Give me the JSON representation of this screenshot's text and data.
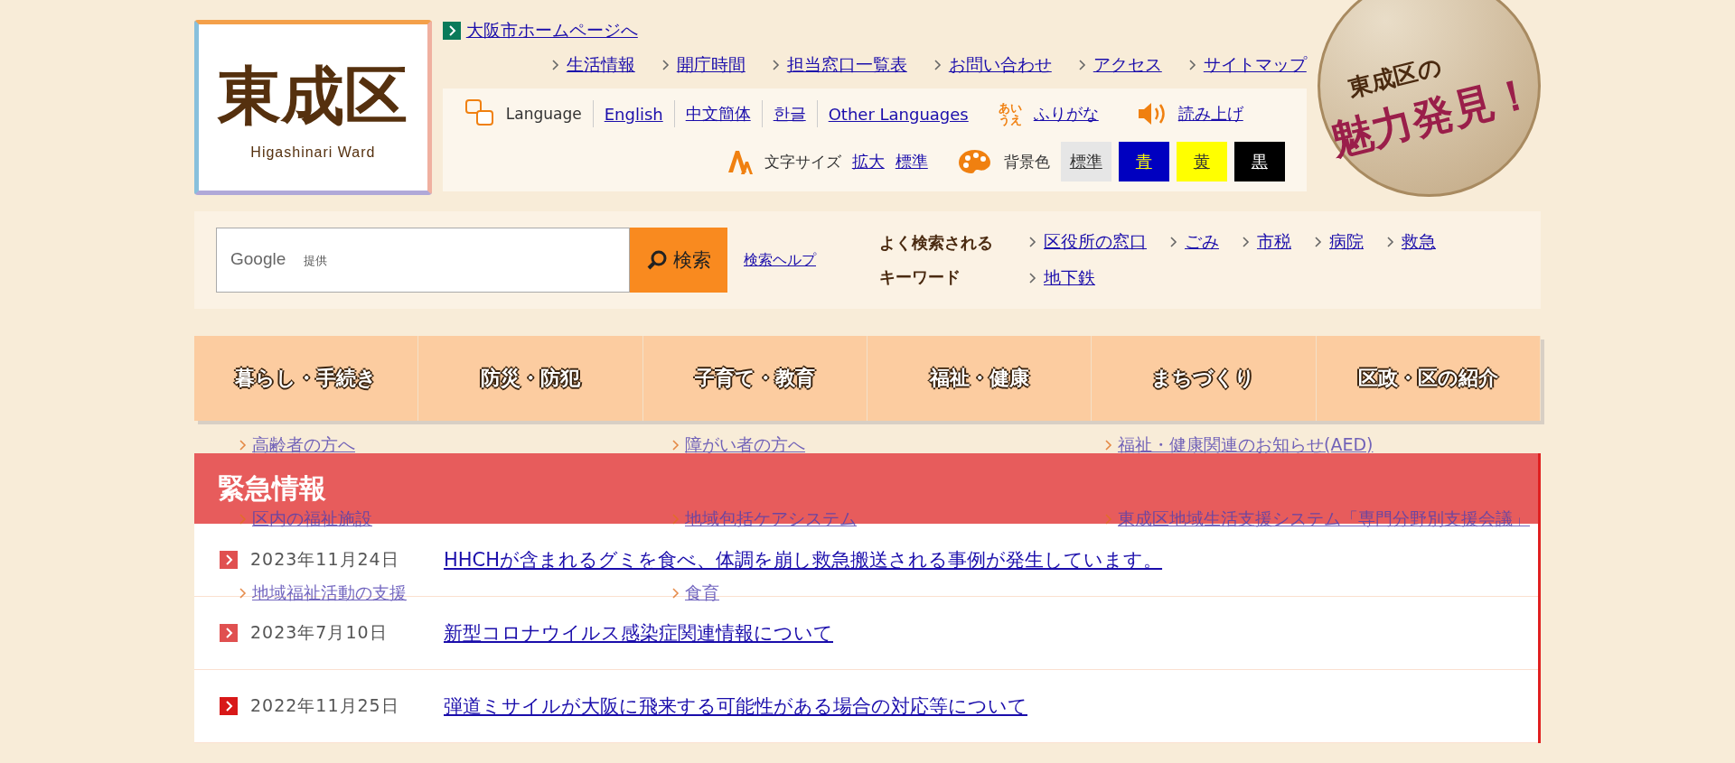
{
  "logo": {
    "title": "東成区",
    "subtitle": "Higashinari Ward"
  },
  "city_link": {
    "label": "大阪市ホームページへ"
  },
  "top_links": [
    "生活情報",
    "開庁時間",
    "担当窓口一覧表",
    "お問い合わせ",
    "アクセス",
    "サイトマップ"
  ],
  "language": {
    "label": "Language",
    "options": [
      "English",
      "中文簡体",
      "한글",
      "Other Languages"
    ]
  },
  "furigana": {
    "icon_text": "あいうえ",
    "label": "ふりがな"
  },
  "read_aloud": {
    "label": "読み上げ"
  },
  "font_size": {
    "label": "文字サイズ",
    "options": [
      "拡大",
      "標準"
    ]
  },
  "background_color": {
    "label": "背景色",
    "options": [
      {
        "label": "標準",
        "color": "#e6e6e6"
      },
      {
        "label": "青",
        "color": "#0000c0"
      },
      {
        "label": "黄",
        "color": "#ffff00"
      },
      {
        "label": "黒",
        "color": "#000000"
      }
    ]
  },
  "banner": {
    "line_1": "東成区の",
    "line_2": "魅力発見！"
  },
  "search": {
    "placeholder": "提供",
    "brand": "Google",
    "button": "検索",
    "help": "検索ヘルプ"
  },
  "keywords": {
    "label_1": "よく検索される",
    "label_2": "キーワード",
    "items": [
      "区役所の窓口",
      "ごみ",
      "市税",
      "病院",
      "救急",
      "地下鉄"
    ]
  },
  "nav": [
    "暮らし・手続き",
    "防災・防犯",
    "子育て・教育",
    "福祉・健康",
    "まちづくり",
    "区政・区の紹介"
  ],
  "submenu": [
    "高齢者の方へ",
    "障がい者の方へ",
    "福祉・健康関連のお知らせ(AED)",
    "区内の福祉施設",
    "地域包括ケアシステム",
    "東成区地域生活支援システム「専門分野別支援会議」",
    "地域福祉活動の支援",
    "食育"
  ],
  "emergency": {
    "title": "緊急情報",
    "items": [
      {
        "date": "2023年11月24日",
        "title": "HHCHが含まれるグミを食べ、体調を崩し救急搬送される事例が発生しています。"
      },
      {
        "date": "2023年7月10日",
        "title": "新型コロナウイルス感染症関連情報について"
      },
      {
        "date": "2022年11月25日",
        "title": "弾道ミサイルが大阪に飛来する可能性がある場合の対応等について"
      }
    ]
  }
}
